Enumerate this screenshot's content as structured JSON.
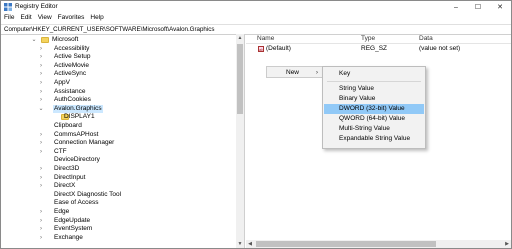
{
  "window": {
    "title": "Registry Editor",
    "controls": {
      "minimize": "–",
      "maximize": "☐",
      "close": "✕"
    }
  },
  "menubar": [
    "File",
    "Edit",
    "View",
    "Favorites",
    "Help"
  ],
  "address": "Computer\\HKEY_CURRENT_USER\\SOFTWARE\\Microsoft\\Avalon.Graphics",
  "tree": {
    "items": [
      {
        "label": "Microsoft",
        "expander": "⌄",
        "level": 0
      },
      {
        "label": "Accessibility",
        "expander": "›",
        "level": 1
      },
      {
        "label": "Active Setup",
        "expander": "›",
        "level": 1
      },
      {
        "label": "ActiveMovie",
        "expander": "›",
        "level": 1
      },
      {
        "label": "ActiveSync",
        "expander": "›",
        "level": 1
      },
      {
        "label": "AppV",
        "expander": "›",
        "level": 1
      },
      {
        "label": "Assistance",
        "expander": "›",
        "level": 1
      },
      {
        "label": "AuthCookies",
        "expander": "›",
        "level": 1
      },
      {
        "label": "Avalon.Graphics",
        "expander": "⌄",
        "level": 1,
        "selected": true
      },
      {
        "label": "DISPLAY1",
        "expander": "",
        "level": 2
      },
      {
        "label": "Clipboard",
        "expander": "",
        "level": 1
      },
      {
        "label": "CommsAPHost",
        "expander": "›",
        "level": 1
      },
      {
        "label": "Connection Manager",
        "expander": "›",
        "level": 1
      },
      {
        "label": "CTF",
        "expander": "›",
        "level": 1
      },
      {
        "label": "DeviceDirectory",
        "expander": "",
        "level": 1
      },
      {
        "label": "Direct3D",
        "expander": "›",
        "level": 1
      },
      {
        "label": "DirectInput",
        "expander": "›",
        "level": 1
      },
      {
        "label": "DirectX",
        "expander": "›",
        "level": 1
      },
      {
        "label": "DirectX Diagnostic Tool",
        "expander": "",
        "level": 1
      },
      {
        "label": "Ease of Access",
        "expander": "",
        "level": 1
      },
      {
        "label": "Edge",
        "expander": "›",
        "level": 1
      },
      {
        "label": "EdgeUpdate",
        "expander": "›",
        "level": 1
      },
      {
        "label": "EventSystem",
        "expander": "›",
        "level": 1
      },
      {
        "label": "Exchange",
        "expander": "›",
        "level": 1
      }
    ]
  },
  "list": {
    "columns": {
      "name": "Name",
      "type": "Type",
      "data": "Data"
    },
    "rows": [
      {
        "icon": "ab",
        "name": "(Default)",
        "type": "REG_SZ",
        "data": "(value not set)"
      }
    ]
  },
  "context_menu": {
    "new_label": "New",
    "arrow": "›"
  },
  "submenu": {
    "key": "Key",
    "string": "String Value",
    "binary": "Binary Value",
    "dword": "DWORD (32-bit) Value",
    "qword": "QWORD (64-bit) Value",
    "multistring": "Multi-String Value",
    "expandable": "Expandable String Value"
  },
  "colors": {
    "highlight": "#91c9f7",
    "selection": "#cce8ff",
    "folder": "#f4d35e"
  },
  "icons": [
    "registry-editor-icon",
    "folder-icon",
    "chevron-right-icon",
    "chevron-down-icon",
    "string-value-icon"
  ]
}
